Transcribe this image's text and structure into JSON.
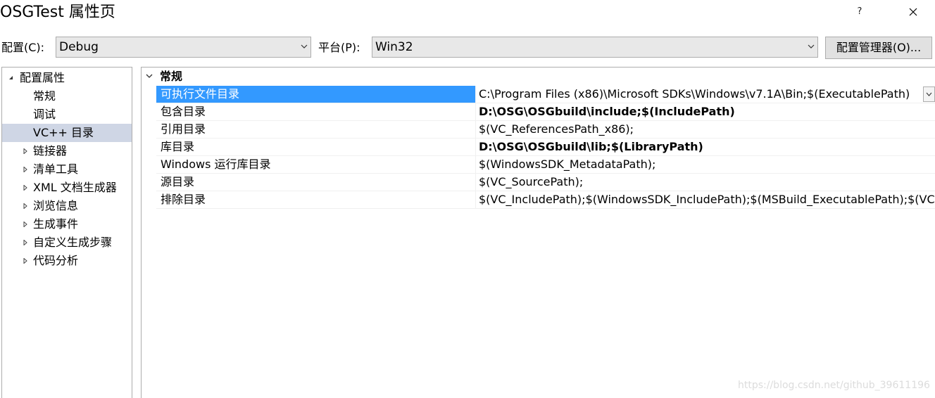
{
  "window": {
    "title": "OSGTest 属性页",
    "help_label": "?"
  },
  "toolbar": {
    "config_label": "配置(C):",
    "config_value": "Debug",
    "platform_label": "平台(P):",
    "platform_value": "Win32",
    "manager_button": "配置管理器(O)..."
  },
  "tree": {
    "items": [
      {
        "label": "配置属性",
        "state": "expanded"
      },
      {
        "label": "常规"
      },
      {
        "label": "调试"
      },
      {
        "label": "VC++ 目录",
        "selected": true
      },
      {
        "label": "链接器",
        "state": "collapsed"
      },
      {
        "label": "清单工具",
        "state": "collapsed"
      },
      {
        "label": "XML 文档生成器",
        "state": "collapsed"
      },
      {
        "label": "浏览信息",
        "state": "collapsed"
      },
      {
        "label": "生成事件",
        "state": "collapsed"
      },
      {
        "label": "自定义生成步骤",
        "state": "collapsed"
      },
      {
        "label": "代码分析",
        "state": "collapsed"
      }
    ]
  },
  "grid": {
    "category": "常规",
    "properties": [
      {
        "name": "可执行文件目录",
        "value": "C:\\Program Files (x86)\\Microsoft SDKs\\Windows\\v7.1A\\Bin;$(ExecutablePath)",
        "selected": true,
        "bold": false
      },
      {
        "name": "包含目录",
        "value": "D:\\OSG\\OSGbuild\\include;$(IncludePath)",
        "bold": true
      },
      {
        "name": "引用目录",
        "value": "$(VC_ReferencesPath_x86);",
        "bold": false
      },
      {
        "name": "库目录",
        "value": "D:\\OSG\\OSGbuild\\lib;$(LibraryPath)",
        "bold": true
      },
      {
        "name": "Windows 运行库目录",
        "value": "$(WindowsSDK_MetadataPath);",
        "bold": false
      },
      {
        "name": "源目录",
        "value": "$(VC_SourcePath);",
        "bold": false
      },
      {
        "name": "排除目录",
        "value": "$(VC_IncludePath);$(WindowsSDK_IncludePath);$(MSBuild_ExecutablePath);$(VC",
        "bold": false
      }
    ]
  },
  "watermark": "https://blog.csdn.net/github_39611196",
  "colors": {
    "selection_blue": "#3399ff",
    "tree_selection": "#cfd6e5",
    "combo_bg": "#e8e8e8",
    "border": "#adadad"
  }
}
